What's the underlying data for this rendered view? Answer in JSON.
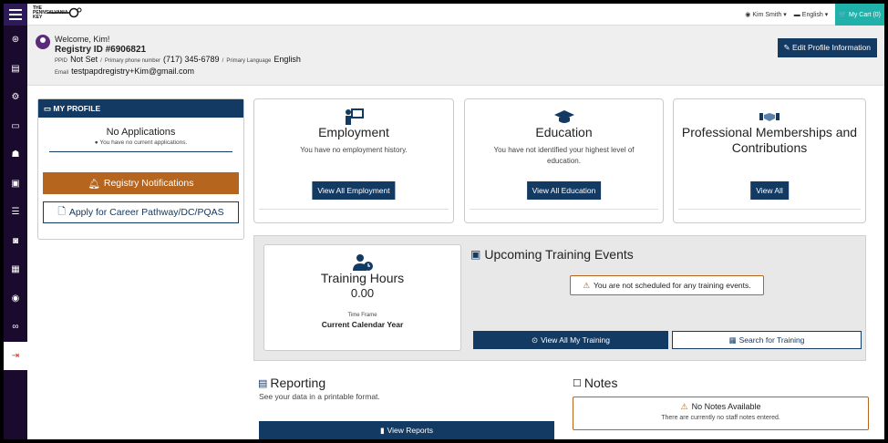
{
  "topbar": {
    "logo_line1": "THE",
    "logo_line2": "PENNSYLVANIA",
    "logo_line3": "KEY",
    "user_name": "Kim Smith",
    "language": "English",
    "cart": "My Cart (0)"
  },
  "sidebar": {
    "items": [
      "gauge-icon",
      "document-icon",
      "cog-icon",
      "id-card-icon",
      "people-icon",
      "clipboard-icon",
      "list-icon",
      "badge-icon",
      "table-icon",
      "circle-icon",
      "link-icon",
      "signout-icon"
    ]
  },
  "header": {
    "welcome": "Welcome, Kim!",
    "registry_id": "Registry ID  #6906821",
    "ppid_label": "PPID",
    "ppid_value": "Not Set",
    "phone_label": "Primary phone number",
    "phone_value": "(717) 345-6789",
    "language_label": "Primary Language",
    "language_value": "English",
    "email_label": "Email",
    "email_value": "testpapdregistry+Kim@gmail.com",
    "edit_button": "Edit Profile Information"
  },
  "profile": {
    "title": "MY PROFILE",
    "no_apps_title": "No Applications",
    "no_apps_sub": "You have no current applications.",
    "notifications_button": "Registry Notifications",
    "apply_button": "Apply for Career Pathway/DC/PQAS"
  },
  "cards": {
    "employment": {
      "title": "Employment",
      "desc": "You have no employment history.",
      "button": "View All Employment"
    },
    "education": {
      "title": "Education",
      "desc": "You have not identified your highest level of education.",
      "button": "View All Education"
    },
    "memberships": {
      "title": "Professional Memberships and Contributions",
      "button": "View All"
    }
  },
  "training": {
    "hours_title": "Training Hours",
    "hours_value": "0.00",
    "time_frame_label": "Time Frame",
    "time_frame_value": "Current Calendar Year",
    "upcoming_title": "Upcoming Training Events",
    "upcoming_warning": "You are not scheduled for any training events.",
    "view_all_button": "View All My Training",
    "search_button": "Search for Training"
  },
  "reporting": {
    "title": "Reporting",
    "subtitle": "See your data in a printable format.",
    "button": "View Reports"
  },
  "notes": {
    "title": "Notes",
    "empty_title": "No Notes Available",
    "empty_sub": "There are currently no staff notes entered."
  },
  "colors": {
    "primary": "#133a63",
    "accent_orange": "#b5651d",
    "sidebar": "#1a0a2e",
    "cart": "#20b2aa"
  }
}
